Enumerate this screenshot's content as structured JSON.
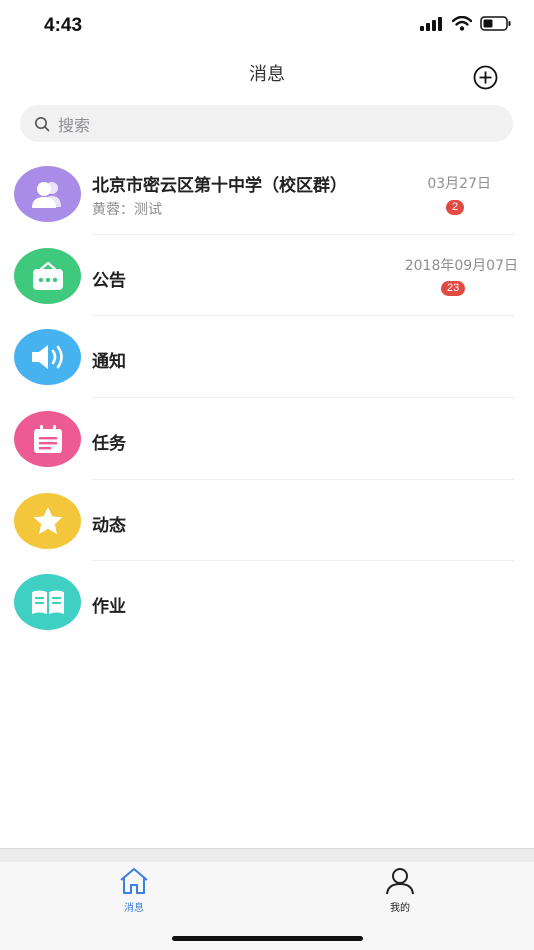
{
  "status_bar": {
    "time": "4:43"
  },
  "header": {
    "title": "消息"
  },
  "search": {
    "placeholder": "搜索"
  },
  "messages": [
    {
      "title": "北京市密云区第十中学（校区群）",
      "subtitle": "黄蓉：测试",
      "date": "03月27日",
      "badge": "2",
      "icon": "group-people-icon",
      "color": "#a98ce8"
    },
    {
      "title": "公告",
      "subtitle": "",
      "date": "2018年09月07日",
      "badge": "23",
      "icon": "announcement-icon",
      "color": "#3fc97c"
    },
    {
      "title": "通知",
      "subtitle": "",
      "date": "",
      "badge": "",
      "icon": "speaker-icon",
      "color": "#47b2f0"
    },
    {
      "title": "任务",
      "subtitle": "",
      "date": "",
      "badge": "",
      "icon": "task-calendar-icon",
      "color": "#ed5a94"
    },
    {
      "title": "动态",
      "subtitle": "",
      "date": "",
      "badge": "",
      "icon": "star-icon",
      "color": "#f3c63b"
    },
    {
      "title": "作业",
      "subtitle": "",
      "date": "",
      "badge": "",
      "icon": "book-icon",
      "color": "#40cfc3"
    }
  ],
  "tabs": [
    {
      "label": "消息",
      "icon": "home-icon",
      "active": true,
      "color": "#3d7fe0"
    },
    {
      "label": "我的",
      "icon": "person-icon",
      "active": false,
      "color": "#222222"
    }
  ]
}
